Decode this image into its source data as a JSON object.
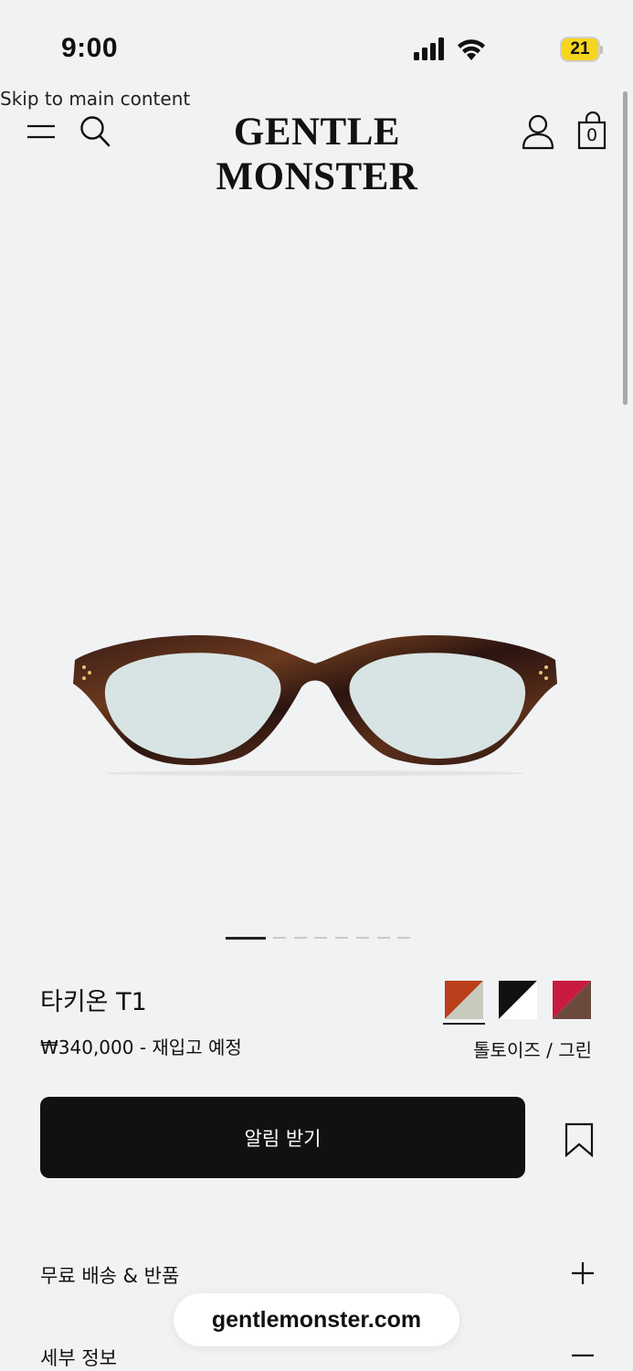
{
  "status_bar": {
    "time": "9:00",
    "battery": "21",
    "icons": [
      "cellular-signal-icon",
      "wifi-icon",
      "battery-icon"
    ]
  },
  "skip_link": "Skip to main content",
  "header": {
    "brand": "GENTLE MONSTER",
    "cart_count": "0",
    "icons": [
      "menu-icon",
      "search-icon",
      "account-icon",
      "shopping-bag-icon"
    ]
  },
  "carousel": {
    "total_slides": 8,
    "active_index": 0
  },
  "product": {
    "name": "타키온 T1",
    "price": "₩340,000 - 재입고 예정",
    "selected_color": "톨토이즈 / 그린",
    "swatches": [
      {
        "name": "tortoise-green",
        "colors": [
          "#b9401a",
          "#c6cbbd"
        ],
        "selected": true
      },
      {
        "name": "black-clear",
        "colors": [
          "#111111",
          "#ffffff"
        ],
        "selected": false
      },
      {
        "name": "red-brown",
        "colors": [
          "#c81a40",
          "#6b4a3d"
        ],
        "selected": false
      }
    ]
  },
  "actions": {
    "notify_label": "알림 받기"
  },
  "accordion": [
    {
      "label": "무료 배송 & 반품",
      "expanded": false
    },
    {
      "label": "세부 정보",
      "expanded": true
    }
  ],
  "browser": {
    "url": "gentlemonster.com"
  },
  "colors": {
    "background": "#f1f2f4",
    "button": "#111111",
    "button_text": "#ffffff"
  }
}
